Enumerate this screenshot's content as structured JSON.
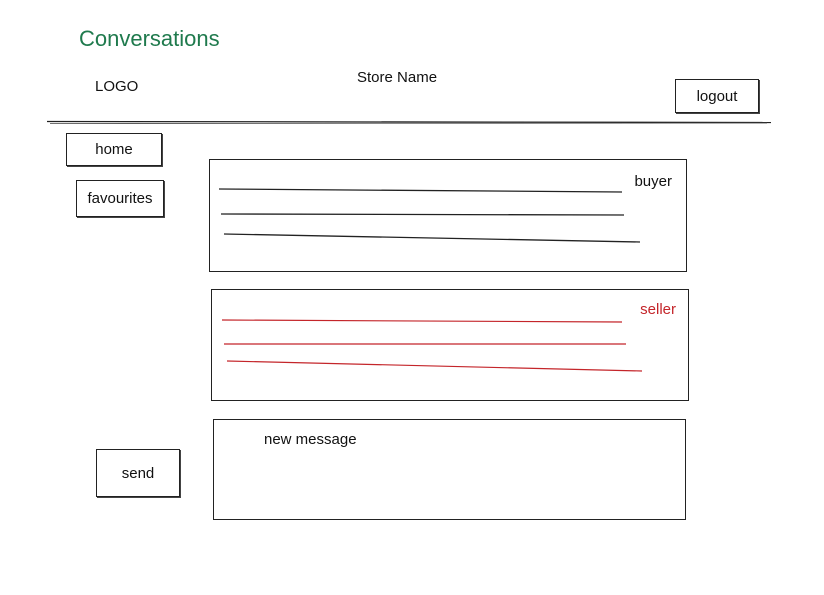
{
  "header": {
    "page_title": "Conversations",
    "logo_text": "LOGO",
    "store_name": "Store Name",
    "logout_label": "logout"
  },
  "sidebar": {
    "items": [
      {
        "label": "home"
      },
      {
        "label": "favourites"
      }
    ]
  },
  "conversation": {
    "messages": [
      {
        "role_label": "buyer",
        "color": "#111111"
      },
      {
        "role_label": "seller",
        "color": "#c4252a"
      }
    ]
  },
  "composer": {
    "placeholder": "new message",
    "send_label": "send"
  },
  "colors": {
    "title": "#1f7a4d",
    "seller_accent": "#c4252a"
  }
}
